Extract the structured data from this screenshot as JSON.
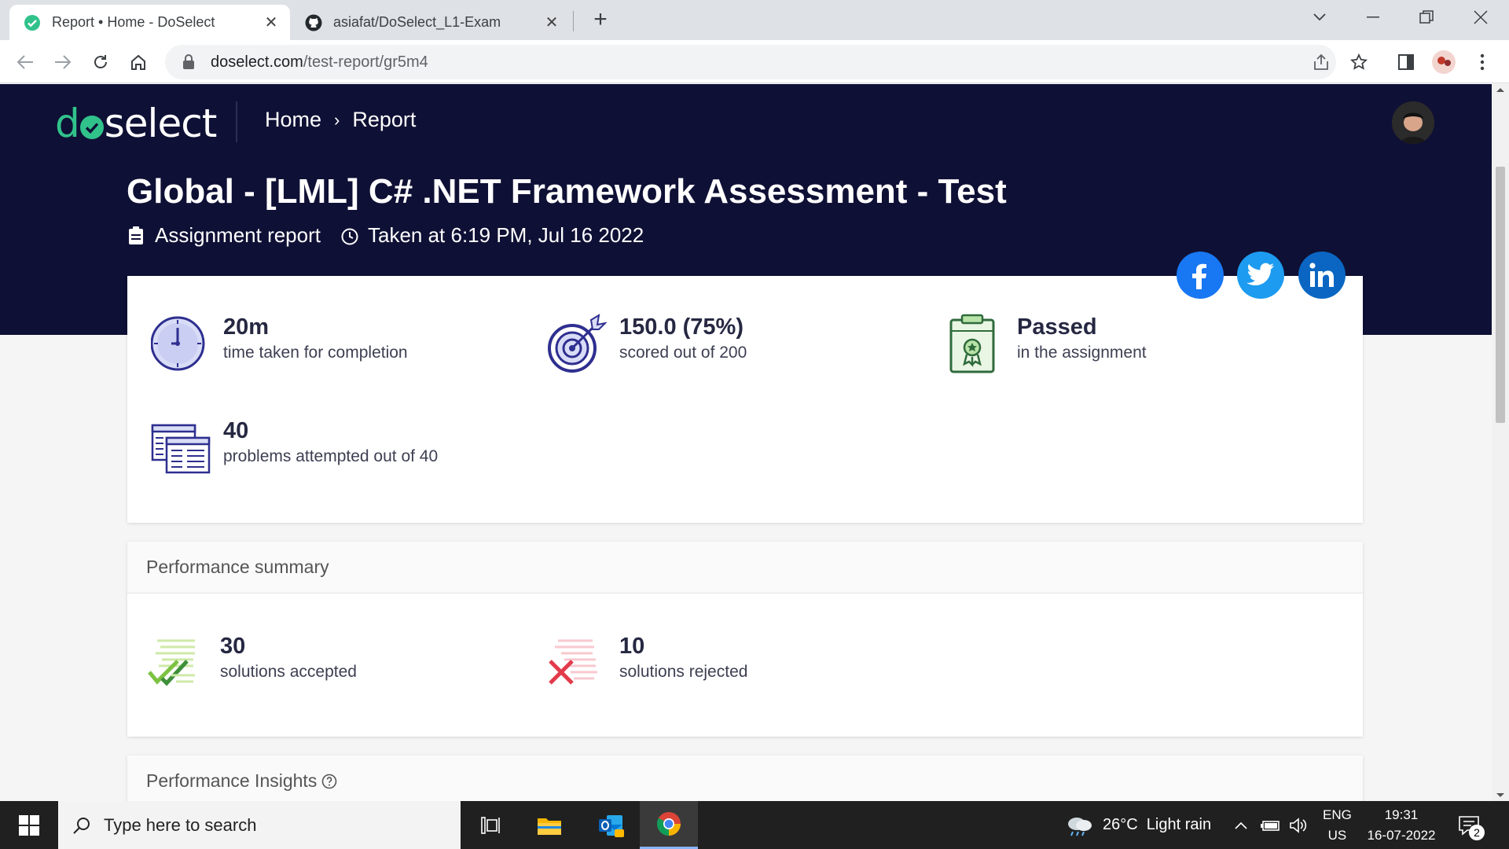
{
  "browser": {
    "tabs": [
      {
        "title": "Report • Home - DoSelect",
        "icon": "check-circle-icon",
        "active": true
      },
      {
        "title": "asiafat/DoSelect_L1-Exam",
        "icon": "github-icon",
        "active": false
      }
    ],
    "url_host": "doselect.com",
    "url_path": "/test-report/gr5m4"
  },
  "header": {
    "logo_d": "d",
    "logo_rest": "select",
    "breadcrumb_home": "Home",
    "breadcrumb_current": "Report"
  },
  "report": {
    "title": "Global - [LML] C# .NET Framework Assessment - Test",
    "type": "Assignment report",
    "taken_at": "Taken at 6:19 PM, Jul 16 2022"
  },
  "stats": [
    {
      "value": "20m",
      "label": "time taken for completion",
      "icon": "clock-icon"
    },
    {
      "value": "150.0 (75%)",
      "label": "scored out of 200",
      "icon": "target-icon"
    },
    {
      "value": "Passed",
      "label": "in the assignment",
      "icon": "certificate-clipboard-icon"
    },
    {
      "value": "40",
      "label": "problems attempted out of 40",
      "icon": "problems-icon"
    }
  ],
  "performance_summary": {
    "heading": "Performance summary",
    "accepted_value": "30",
    "accepted_label": "solutions accepted",
    "rejected_value": "10",
    "rejected_label": "solutions rejected"
  },
  "performance_insights": {
    "heading": "Performance Insights"
  },
  "taskbar": {
    "search_placeholder": "Type here to search",
    "weather": "26°C  Light rain",
    "lang_top": "ENG",
    "lang_bottom": "US",
    "time": "19:31",
    "date": "16-07-2022",
    "notification_count": "2"
  },
  "colors": {
    "hero": "#0f1035",
    "brand_green": "#31c28b",
    "facebook": "#1877f2",
    "twitter": "#1d9bf0",
    "linkedin": "#0a66c2"
  }
}
